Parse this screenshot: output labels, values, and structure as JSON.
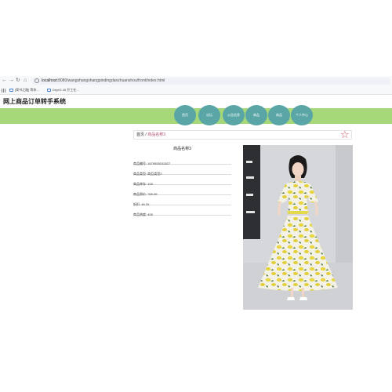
{
  "browser": {
    "url_host": "localhost",
    "url_rest": ":8080/wangshangshangpindingdanzhuanshou/front/index.html",
    "bookmarks": [
      "[简书之路] 等你...",
      "DeptG 45 开工在..."
    ]
  },
  "site": {
    "title": "网上商品订单转手系统"
  },
  "nav": {
    "items": [
      "首页",
      "论坛",
      "公告信息",
      "商品",
      "商品",
      "个人中心"
    ]
  },
  "breadcrumb": {
    "home": "首页",
    "separator": " / ",
    "current": "商品名称3"
  },
  "product": {
    "name": "商品名称3",
    "fields": [
      "商品编号: 1679555102827",
      "商品类型: 商品类型2",
      "商品库存: 103",
      "商品原价: 765.39",
      "折扣: 46.16",
      "商品热度: 405"
    ]
  },
  "icons": {
    "favorite": "star-outline-icon"
  },
  "colors": {
    "nav_band": "#a6d87a",
    "nav_tab": "#5aa6a6",
    "accent": "#d44a5a"
  }
}
